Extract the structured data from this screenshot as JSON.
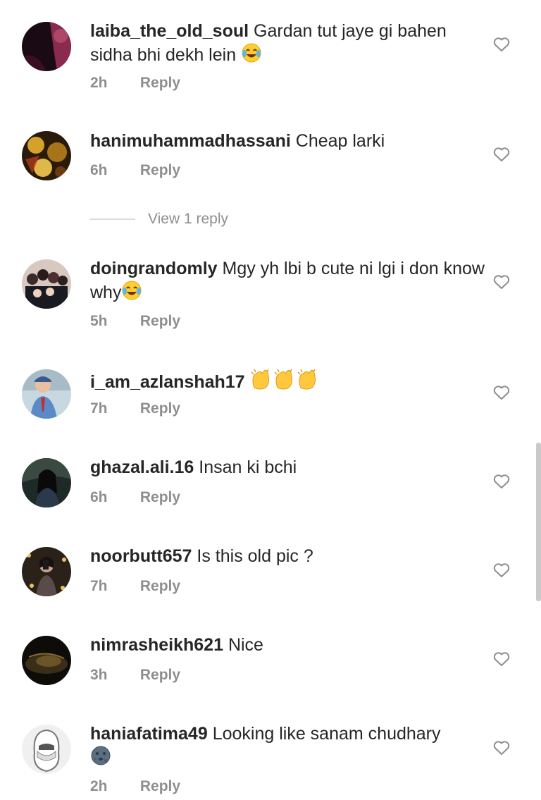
{
  "comments": [
    {
      "username": "laiba_the_old_soul",
      "text": "Gardan tut jaye gi bahen sidha bhi dekh lein",
      "time": "2h",
      "reply_label": "Reply",
      "emoji": "tears-of-joy-emoji"
    },
    {
      "username": "hanimuhammadhassani",
      "text": "Cheap larki",
      "time": "6h",
      "reply_label": "Reply"
    },
    {
      "username": "doingrandomly",
      "text": "Mgy yh lbi b cute ni lgi i don know why",
      "time": "5h",
      "reply_label": "Reply",
      "emoji": "tears-of-joy-emoji"
    },
    {
      "username": "i_am_azlanshah17",
      "text": "",
      "time": "7h",
      "reply_label": "Reply",
      "emoji": "clapping-hands-emoji x3"
    },
    {
      "username": "ghazal.ali.16",
      "text": "Insan ki bchi",
      "time": "6h",
      "reply_label": "Reply"
    },
    {
      "username": "noorbutt657",
      "text": "Is this old pic ?",
      "time": "7h",
      "reply_label": "Reply"
    },
    {
      "username": "nimrasheikh621",
      "text": "Nice",
      "time": "3h",
      "reply_label": "Reply"
    },
    {
      "username": "haniafatima49",
      "text": "Looking like sanam chudhary",
      "time": "2h",
      "reply_label": "Reply",
      "emoji": "new-moon-face-emoji"
    }
  ],
  "view_replies_label": "View 1 reply",
  "icons": {
    "like": "heart-outline-icon"
  },
  "colors": {
    "text": "#262626",
    "meta": "#8e8e8e",
    "divider": "#dbdbdb"
  }
}
